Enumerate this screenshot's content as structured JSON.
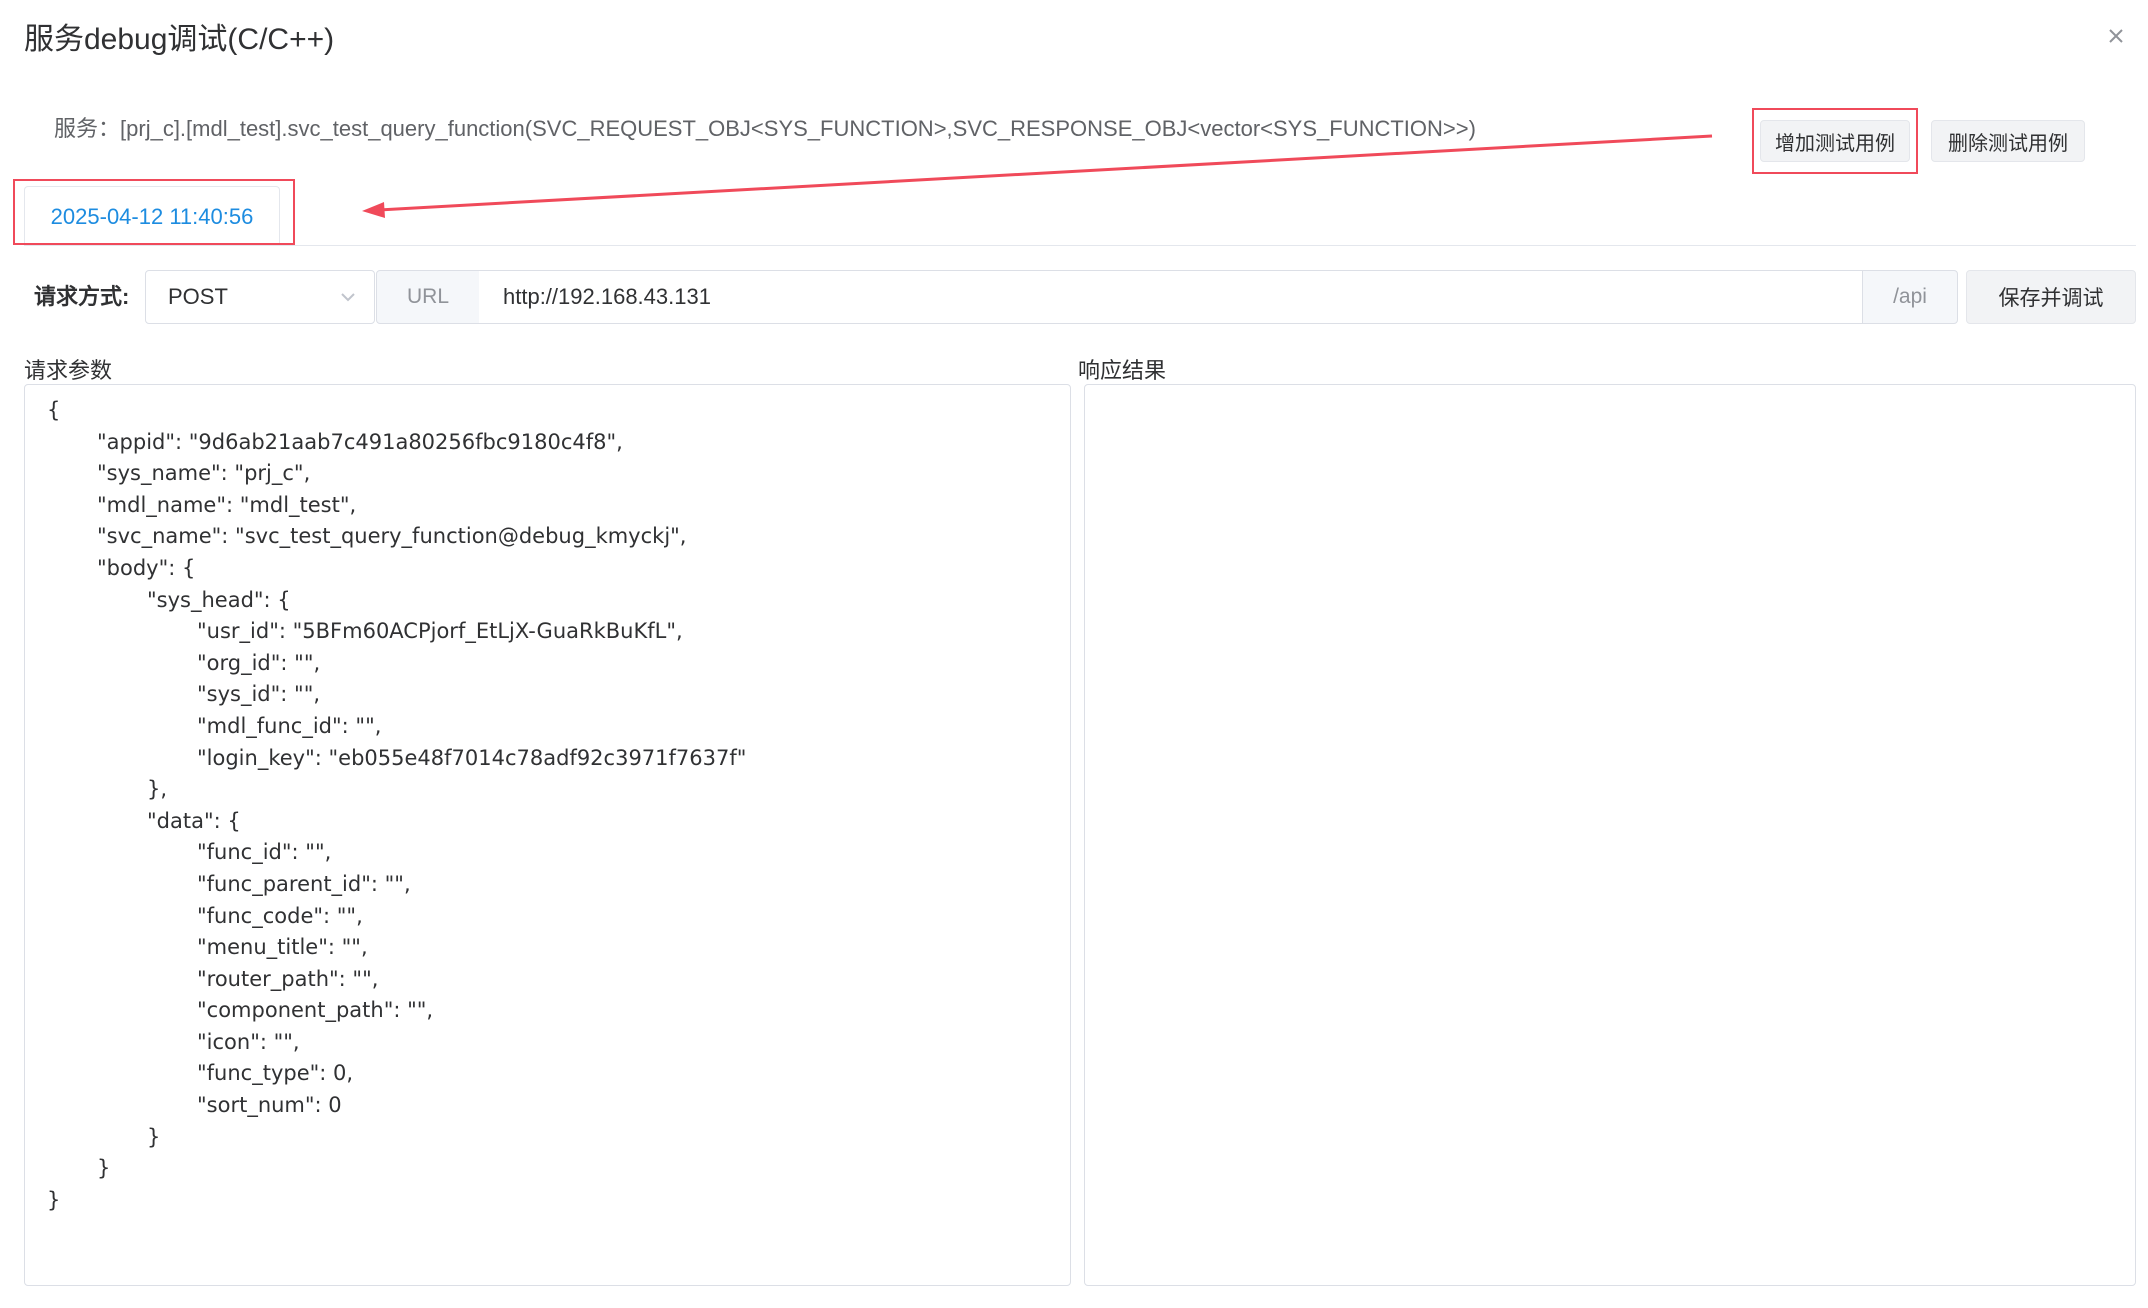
{
  "dialog": {
    "title": "服务debug调试(C/C++)"
  },
  "service": {
    "label": "服务：",
    "signature": "[prj_c].[mdl_test].svc_test_query_function(SVC_REQUEST_OBJ<SYS_FUNCTION>,SVC_RESPONSE_OBJ<vector<SYS_FUNCTION>>)"
  },
  "buttons": {
    "add_test_case": "增加测试用例",
    "delete_test_case": "删除测试用例",
    "save_and_debug": "保存并调试"
  },
  "tabs": [
    {
      "label": "2025-04-12 11:40:56",
      "active": true
    }
  ],
  "request": {
    "method_label": "请求方式:",
    "method_value": "POST",
    "url_prefix": "URL",
    "url_value": "http://192.168.43.131",
    "url_suffix": "/api"
  },
  "panels": {
    "params_label": "请求参数",
    "response_label": "响应结果"
  },
  "request_params": [
    {
      "indent": 0,
      "text": "{"
    },
    {
      "indent": 1,
      "text": "\"appid\": \"9d6ab21aab7c491a80256fbc9180c4f8\","
    },
    {
      "indent": 1,
      "text": "\"sys_name\": \"prj_c\","
    },
    {
      "indent": 1,
      "text": "\"mdl_name\": \"mdl_test\","
    },
    {
      "indent": 1,
      "text": "\"svc_name\": \"svc_test_query_function@debug_kmyckj\","
    },
    {
      "indent": 1,
      "text": "\"body\": {"
    },
    {
      "indent": 2,
      "text": "\"sys_head\": {"
    },
    {
      "indent": 3,
      "text": "\"usr_id\": \"5BFm60ACPjorf_EtLjX-GuaRkBuKfL\","
    },
    {
      "indent": 3,
      "text": "\"org_id\": \"\","
    },
    {
      "indent": 3,
      "text": "\"sys_id\": \"\","
    },
    {
      "indent": 3,
      "text": "\"mdl_func_id\": \"\","
    },
    {
      "indent": 3,
      "text": "\"login_key\": \"eb055e48f7014c78adf92c3971f7637f\""
    },
    {
      "indent": 2,
      "text": "},"
    },
    {
      "indent": 2,
      "text": "\"data\": {"
    },
    {
      "indent": 3,
      "text": "\"func_id\": \"\","
    },
    {
      "indent": 3,
      "text": "\"func_parent_id\": \"\","
    },
    {
      "indent": 3,
      "text": "\"func_code\": \"\","
    },
    {
      "indent": 3,
      "text": "\"menu_title\": \"\","
    },
    {
      "indent": 3,
      "text": "\"router_path\": \"\","
    },
    {
      "indent": 3,
      "text": "\"component_path\": \"\","
    },
    {
      "indent": 3,
      "text": "\"icon\": \"\","
    },
    {
      "indent": 3,
      "text": "\"func_type\": 0,"
    },
    {
      "indent": 3,
      "text": "\"sort_num\": 0"
    },
    {
      "indent": 2,
      "text": "}"
    },
    {
      "indent": 1,
      "text": "}"
    },
    {
      "indent": 0,
      "text": "}"
    }
  ],
  "response_result": "",
  "annotation": {
    "color": "#f04a5a"
  }
}
